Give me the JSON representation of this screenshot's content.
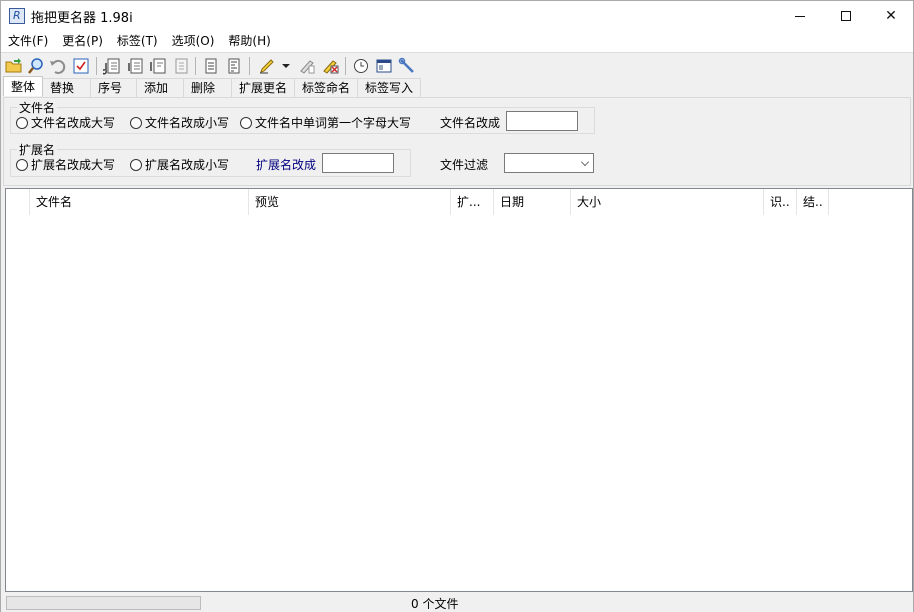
{
  "window": {
    "title": "拖把更名器 1.98i",
    "controls": {
      "minimize": "minimize",
      "maximize": "maximize",
      "close": "✕"
    }
  },
  "menu": [
    "文件(F)",
    "更名(P)",
    "标签(T)",
    "选项(O)",
    "帮助(H)"
  ],
  "toolbar": {
    "icons": [
      "open-folder-icon",
      "search-icon",
      "undo-icon",
      "checklist-icon",
      "tag-read-icon",
      "tag-write-icon",
      "tag-edit-icon",
      "tag-clear-icon",
      "text-file-icon",
      "text-list-icon",
      "highlighter-icon",
      "dropdown-arrow-icon",
      "eraser-icon",
      "delete-tag-icon",
      "clock-icon",
      "panel-icon",
      "tools-icon"
    ]
  },
  "tabs": [
    "整体",
    "替换",
    "序号",
    "添加",
    "删除",
    "扩展更名",
    "标签命名",
    "标签写入"
  ],
  "active_tab": 0,
  "panel": {
    "filename_group": {
      "label": "文件名",
      "options": [
        "文件名改成大写",
        "文件名改成小写",
        "文件名中单词第一个字母大写"
      ],
      "rename_label": "文件名改成",
      "rename_value": ""
    },
    "ext_group": {
      "label": "扩展名",
      "options": [
        "扩展名改成大写",
        "扩展名改成小写"
      ],
      "rename_label": "扩展名改成",
      "rename_value": ""
    },
    "filter_label": "文件过滤",
    "filter_value": ""
  },
  "list": {
    "columns": [
      "文件名",
      "预览",
      "扩...",
      "日期",
      "大小",
      "识..",
      "结.."
    ],
    "rows": []
  },
  "status": {
    "progress": 0,
    "file_count_text": "0 个文件"
  }
}
